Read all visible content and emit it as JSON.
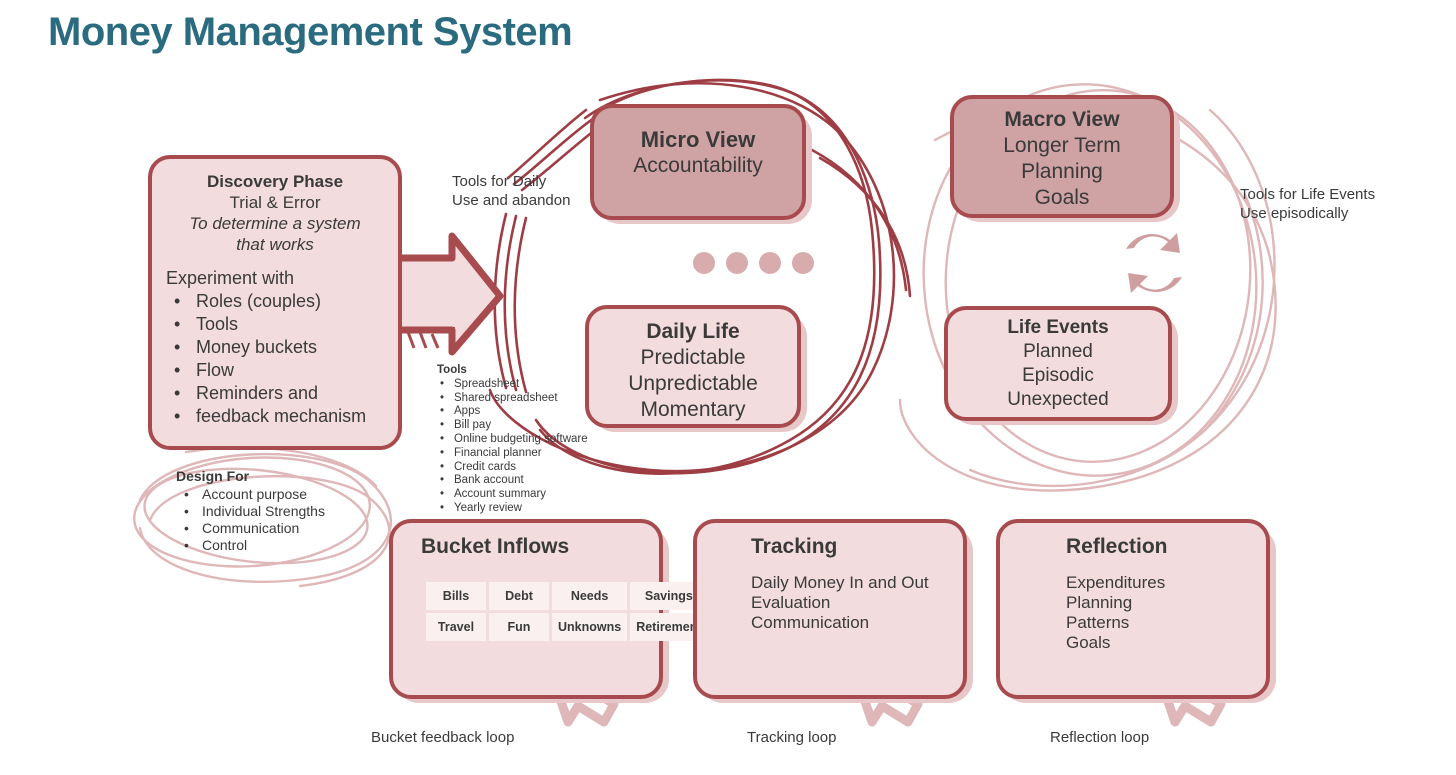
{
  "title": "Money Management System",
  "colors": {
    "title": "#2b6b80",
    "box_border": "#a84b4f",
    "box_fill_light": "#f2dcdd",
    "box_fill_dark": "#cfa3a4",
    "sketch_dark": "#9e3d44",
    "sketch_light": "#dfb7b8",
    "table_cell": "#faf0f0"
  },
  "discovery": {
    "heading": "Discovery Phase",
    "subtitle": "Trial & Error",
    "italic_line1": "To determine a system",
    "italic_line2": "that works",
    "experiment_label": "Experiment with",
    "items": [
      "Roles (couples)",
      "Tools",
      "Money buckets",
      "Flow",
      "Reminders and",
      "feedback mechanism"
    ]
  },
  "design_for": {
    "heading": "Design For",
    "items": [
      "Account purpose",
      "Individual Strengths",
      "Communication",
      "Control"
    ]
  },
  "tools": {
    "heading": "Tools",
    "items": [
      "Spreadsheet",
      "Shared spreadsheet",
      "Apps",
      "Bill pay",
      "Online budgeting software",
      "Financial planner",
      "Credit cards",
      "Bank account",
      "Account summary",
      "Yearly review"
    ]
  },
  "labels": {
    "daily_tools_line1": "Tools for Daily",
    "daily_tools_line2": "Use and abandon",
    "life_tools_line1": "Tools for Life Events",
    "life_tools_line2": "Use episodically"
  },
  "micro": {
    "heading": "Micro View",
    "lines": [
      "Accountability"
    ]
  },
  "daily": {
    "heading": "Daily Life",
    "lines": [
      "Predictable",
      "Unpredictable",
      "Momentary"
    ]
  },
  "macro": {
    "heading": "Macro View",
    "lines": [
      "Longer Term",
      "Planning",
      "Goals"
    ]
  },
  "life_events": {
    "heading": "Life Events",
    "lines": [
      "Planned",
      "Episodic",
      "Unexpected"
    ]
  },
  "bucket": {
    "heading": "Bucket Inflows",
    "rows": [
      [
        "Bills",
        "Debt",
        "Needs",
        "Savings"
      ],
      [
        "Travel",
        "Fun",
        "Unknowns",
        "Retirement"
      ]
    ],
    "loop_label": "Bucket feedback loop"
  },
  "tracking": {
    "heading": "Tracking",
    "lines": [
      "Daily Money In and Out",
      "Evaluation",
      "Communication"
    ],
    "loop_label": "Tracking loop"
  },
  "reflection": {
    "heading": "Reflection",
    "lines": [
      "Expenditures",
      "Planning",
      "Patterns",
      "Goals"
    ],
    "loop_label": "Reflection loop"
  },
  "icons": {
    "swap": "swap-cycle-icon",
    "loop": "circular-arrow-loop-icon",
    "arrow": "block-arrow-right-icon",
    "dots": "four-dots-separator"
  }
}
